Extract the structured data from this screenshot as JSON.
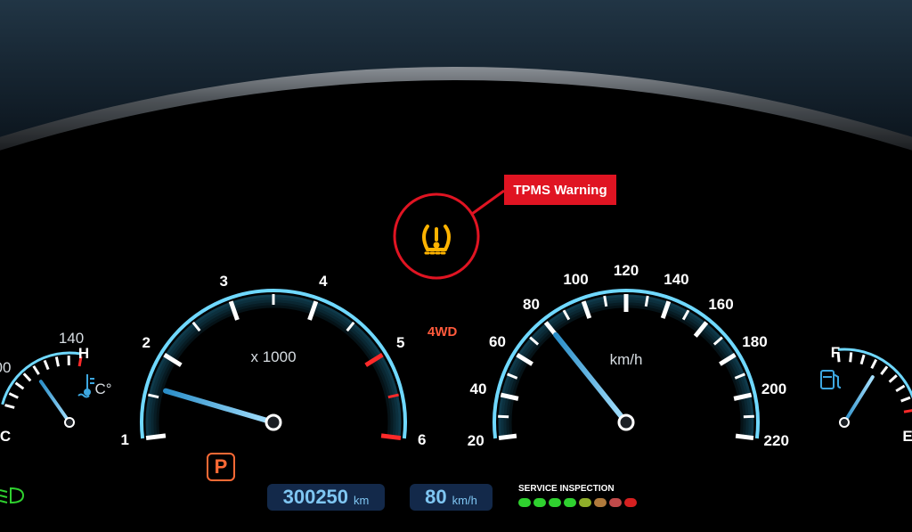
{
  "warning": {
    "label": "TPMS Warning",
    "icon": "tpms-tire-pressure-icon",
    "highlight_color": "#e01422"
  },
  "drive_mode": "4WD",
  "gear": "P",
  "tachometer": {
    "labels": [
      "1",
      "2",
      "3",
      "4",
      "5",
      "6"
    ],
    "unit": "x 1000",
    "needle_value": 1.6,
    "redline_from": 5
  },
  "speedometer": {
    "labels": [
      "20",
      "40",
      "60",
      "80",
      "100",
      "120",
      "140",
      "160",
      "180",
      "200",
      "220"
    ],
    "unit": "km/h",
    "needle_value": 80
  },
  "temperature_gauge": {
    "labels": [
      "140",
      "H",
      "C",
      "00"
    ],
    "unit_symbol": "C°",
    "icon": "coolant-temperature-icon"
  },
  "fuel_gauge": {
    "labels": [
      "F",
      "E"
    ],
    "icon": "fuel-pump-icon"
  },
  "odometer": {
    "value": "300250",
    "unit": "km"
  },
  "speed_readout": {
    "value": "80",
    "unit": "km/h"
  },
  "service_inspection": {
    "label": "SERVICE INSPECTION",
    "indicator_colors": [
      "#2fd12f",
      "#2fd12f",
      "#2fd12f",
      "#2fd12f",
      "#8fae2a",
      "#b07a3c",
      "#c04a4a",
      "#d62020"
    ]
  },
  "headlight_icon": "low-beam-headlight-icon",
  "colors": {
    "gauge_glow": "#4dc3ea",
    "redline": "#ff2a2a",
    "warning_amber": "#ffb300",
    "accent_orange": "#ff6a35"
  }
}
